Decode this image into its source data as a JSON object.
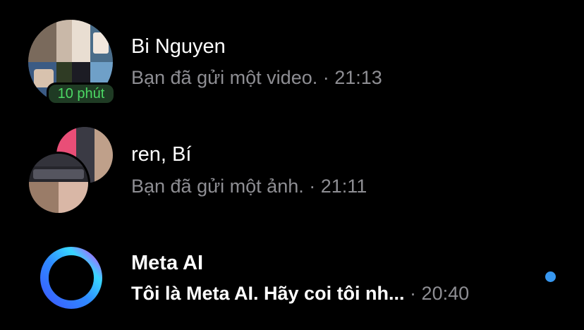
{
  "conversations": [
    {
      "name": "Bi Nguyen",
      "preview": "Bạn đã gửi một video.",
      "separator": " · ",
      "time": "21:13",
      "status": "10 phút"
    },
    {
      "name": "ren, Bí",
      "preview": "Bạn đã gửi một ảnh.",
      "separator": " · ",
      "time": "21:11"
    },
    {
      "name": "Meta AI",
      "preview": "Tôi là Meta AI. Hãy coi tôi nh...",
      "separator": "  · ",
      "time": "20:40",
      "unread": true
    }
  ],
  "colors": {
    "background": "#000000",
    "secondary_text": "#8e8e93",
    "active_status": "#4cd964",
    "unread_dot": "#3797f0"
  },
  "icons": {
    "meta_ai_avatar": "meta-ai-ring-icon"
  }
}
